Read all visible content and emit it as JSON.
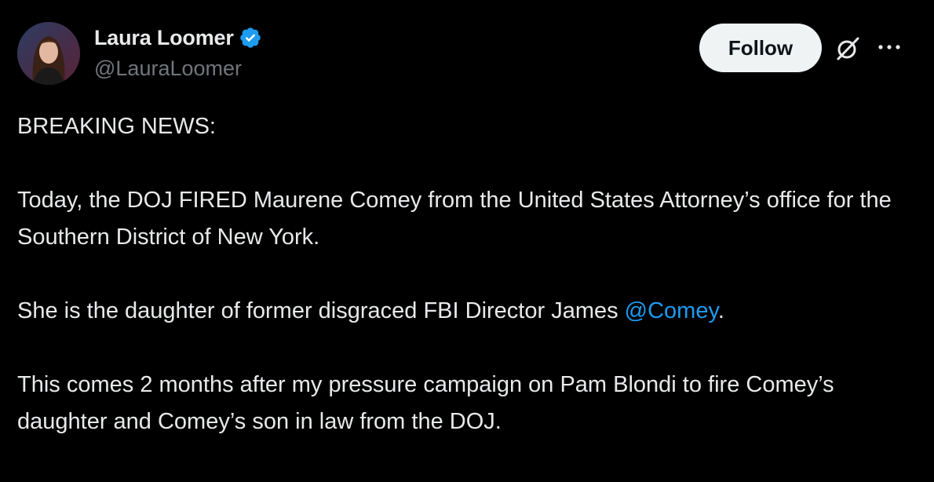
{
  "author": {
    "name": "Laura Loomer",
    "handle": "@LauraLoomer",
    "verified": true,
    "avatar": "profile-photo"
  },
  "actions": {
    "follow_label": "Follow",
    "grok_icon": "grok-slash-circle-icon",
    "more_icon": "more-horizontal-icon"
  },
  "tweet": {
    "line1": "BREAKING NEWS:",
    "para2": "Today, the DOJ FIRED Maurene Comey from the United States Attorney’s office for the Southern District of New York.",
    "para3_before": "She is the daughter of former disgraced FBI Director James ",
    "para3_mention": "@Comey",
    "para3_after": ".",
    "para4": "This comes 2 months after my pressure campaign on Pam Blondi to fire Comey’s daughter and Comey’s son in law from the DOJ."
  },
  "colors": {
    "background": "#000000",
    "text": "#e7e9ea",
    "secondary": "#71767b",
    "link": "#1d9bf0",
    "verified": "#1d9bf0",
    "button_bg": "#eff3f4"
  }
}
